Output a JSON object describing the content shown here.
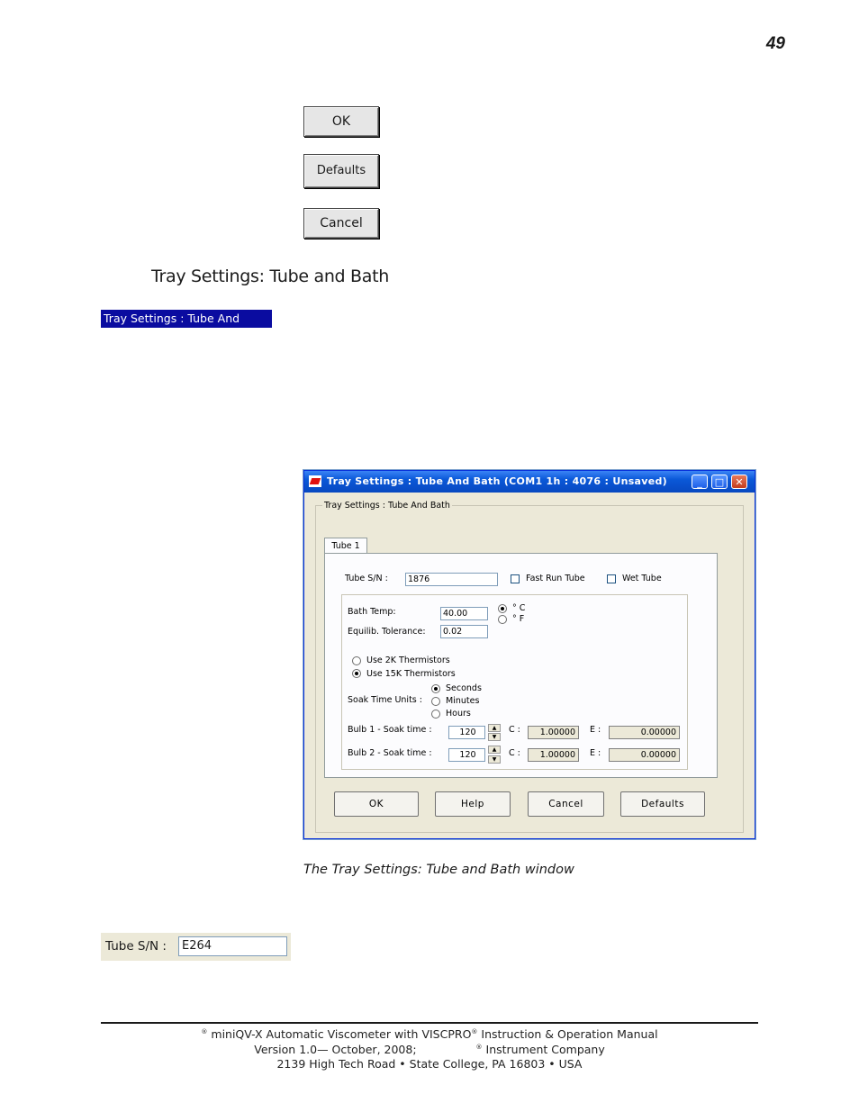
{
  "page_number": "49",
  "top_buttons": {
    "ok": "OK",
    "defaults": "Defaults",
    "cancel": "Cancel"
  },
  "section_title": "Tray Settings: Tube and Bath",
  "menu_title": "Tray Settings : Tube And Bath...",
  "dialog": {
    "title": "Tray Settings : Tube And Bath (COM1 1h : 4076 : Unsaved)",
    "group_label": "Tray Settings : Tube And Bath",
    "tab_label": "Tube 1",
    "tube_sn_label": "Tube S/N :",
    "tube_sn_value": "1876",
    "fast_run_label": "Fast Run Tube",
    "wet_tube_label": "Wet Tube",
    "bath_temp_label": "Bath Temp:",
    "bath_temp_value": "40.00",
    "unit_c": "° C",
    "unit_f": "° F",
    "equilib_label": "Equilib. Tolerance:",
    "equilib_value": "0.02",
    "thermistor_2k": "Use 2K Thermistors",
    "thermistor_15k": "Use 15K Thermistors",
    "soak_units_label": "Soak Time Units :",
    "soak_seconds": "Seconds",
    "soak_minutes": "Minutes",
    "soak_hours": "Hours",
    "bulb1_label": "Bulb 1 - Soak time :",
    "bulb1_value": "120",
    "bulb1_c_label": "C :",
    "bulb1_c_value": "1.00000",
    "bulb1_e_label": "E :",
    "bulb1_e_value": "0.00000",
    "bulb2_label": "Bulb 2 - Soak time :",
    "bulb2_value": "120",
    "bulb2_c_label": "C :",
    "bulb2_c_value": "1.00000",
    "bulb2_e_label": "E :",
    "bulb2_e_value": "0.00000",
    "ok_label": "OK",
    "help_label": "Help",
    "cancel_label": "Cancel",
    "defaults_label": "Defaults"
  },
  "caption": "The Tray Settings: Tube and Bath window",
  "tube_sn_example": {
    "label": "Tube S/N :",
    "value": "E264"
  },
  "footer": {
    "line1_a": "miniQV-X Automatic Viscometer with VISCPRO",
    "line1_b": " Instruction & Operation Manual",
    "line2_a": "Version 1.0— October, 2008;",
    "line2_b": " Instrument Company",
    "line3": "2139 High Tech Road • State College, PA  16803 • USA",
    "registered_mark": "®"
  }
}
